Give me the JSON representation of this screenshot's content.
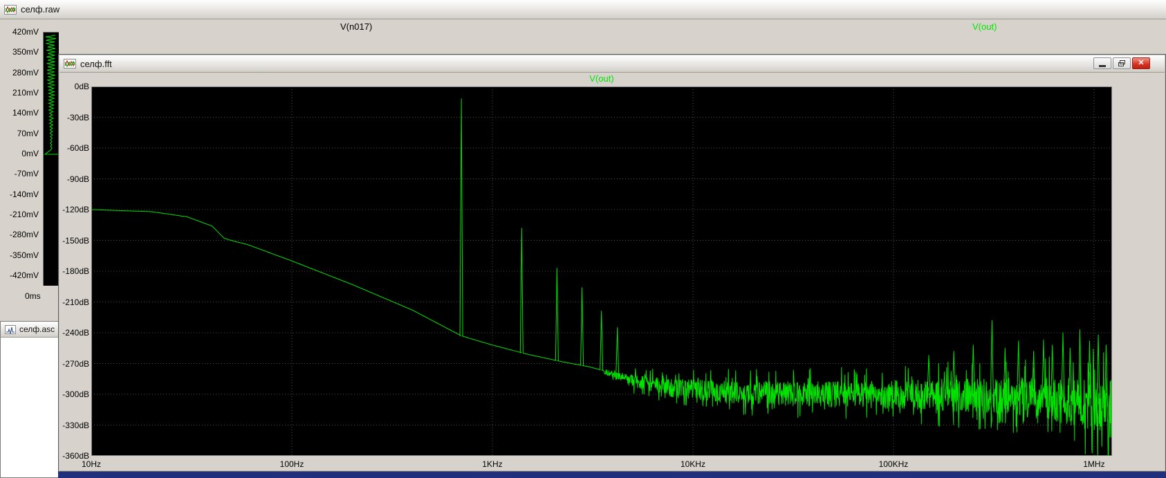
{
  "colors": {
    "trace_green": "#00e400",
    "trace_black": "#000000",
    "plot_background": "#000000",
    "grid": "#4d4d4d",
    "chrome_gray": "#d7d3cc",
    "close_button_red": "#d6301f",
    "bottom_strip_blue": "#20307c"
  },
  "raw_window": {
    "title": "селф.raw",
    "trace_labels": [
      {
        "label": "V(n017)",
        "color": "#000000"
      },
      {
        "label": "V(out)",
        "color": "#00e400"
      }
    ],
    "y_ticks": [
      "420mV",
      "350mV",
      "280mV",
      "210mV",
      "140mV",
      "70mV",
      "0mV",
      "-70mV",
      "-140mV",
      "-210mV",
      "-280mV",
      "-350mV",
      "-420mV"
    ],
    "x_tick": "0ms"
  },
  "fft_window": {
    "title": "селф.fft",
    "trace_label": "V(out)",
    "icons": {
      "minimize": "minimize-bar",
      "restore": "restore-overlapping-squares",
      "close": "✕"
    }
  },
  "asc_window": {
    "title": "селф.asc"
  },
  "chart_data": [
    {
      "type": "line",
      "series": "V(out)",
      "legend_position": "top-center",
      "grid": true,
      "x_axis": {
        "scale": "log",
        "ticks": [
          "10Hz",
          "100Hz",
          "1KHz",
          "10KHz",
          "100KHz",
          "1MHz"
        ],
        "range_hz": [
          10,
          1230000
        ]
      },
      "y_axis": {
        "ticks": [
          "0dB",
          "-30dB",
          "-60dB",
          "-90dB",
          "-120dB",
          "-150dB",
          "-180dB",
          "-210dB",
          "-240dB",
          "-270dB",
          "-300dB",
          "-330dB",
          "-360dB"
        ],
        "range_db": [
          -360,
          0
        ]
      },
      "baseline_points_hz_db": [
        [
          10,
          -120
        ],
        [
          20,
          -122
        ],
        [
          30,
          -127
        ],
        [
          40,
          -136
        ],
        [
          46,
          -148
        ],
        [
          52,
          -151
        ],
        [
          60,
          -154
        ],
        [
          100,
          -170
        ],
        [
          200,
          -193
        ],
        [
          400,
          -218
        ],
        [
          700,
          -243
        ],
        [
          1000,
          -252
        ],
        [
          1500,
          -261
        ],
        [
          2200,
          -268
        ],
        [
          3000,
          -273
        ],
        [
          3600,
          -277
        ]
      ],
      "harmonic_peaks_hz_db": [
        [
          700,
          -12
        ],
        [
          1400,
          -138
        ],
        [
          2100,
          -177
        ],
        [
          2800,
          -196
        ],
        [
          3500,
          -219
        ],
        [
          4200,
          -235
        ]
      ],
      "noise_band": {
        "start_hz": 3600,
        "center_hz_db": [
          [
            3600,
            -278
          ],
          [
            5000,
            -287
          ],
          [
            8000,
            -294
          ],
          [
            15000,
            -298
          ],
          [
            40000,
            -300
          ],
          [
            100000,
            -300
          ],
          [
            250000,
            -301
          ],
          [
            500000,
            -303
          ],
          [
            800000,
            -307
          ],
          [
            1230000,
            -313
          ]
        ],
        "halfwidth_hz_db": [
          [
            3600,
            2.5
          ],
          [
            5000,
            6
          ],
          [
            8000,
            9
          ],
          [
            15000,
            11
          ],
          [
            60000,
            13
          ],
          [
            150000,
            15
          ],
          [
            300000,
            17
          ],
          [
            600000,
            21
          ],
          [
            900000,
            25
          ],
          [
            1230000,
            30
          ]
        ],
        "spike_peaks_hz_db": [
          [
            150000,
            -262
          ],
          [
            200000,
            -258
          ],
          [
            250000,
            -252
          ],
          [
            310000,
            -228
          ],
          [
            360000,
            -255
          ],
          [
            420000,
            -248
          ],
          [
            500000,
            -258
          ],
          [
            560000,
            -247
          ],
          [
            620000,
            -252
          ],
          [
            700000,
            -240
          ],
          [
            760000,
            -255
          ],
          [
            850000,
            -237
          ],
          [
            950000,
            -248
          ],
          [
            1050000,
            -242
          ],
          [
            1150000,
            -252
          ]
        ]
      }
    },
    {
      "type": "line",
      "series": [
        "V(n017)",
        "V(out)"
      ],
      "y_axis": {
        "ticks": [
          "420mV",
          "350mV",
          "280mV",
          "210mV",
          "140mV",
          "70mV",
          "0mV",
          "-70mV",
          "-140mV",
          "-210mV",
          "-280mV",
          "-350mV",
          "-420mV"
        ],
        "range_mv": [
          -420,
          420
        ]
      },
      "x_axis": {
        "ticks_visible": [
          "0ms"
        ]
      }
    }
  ]
}
